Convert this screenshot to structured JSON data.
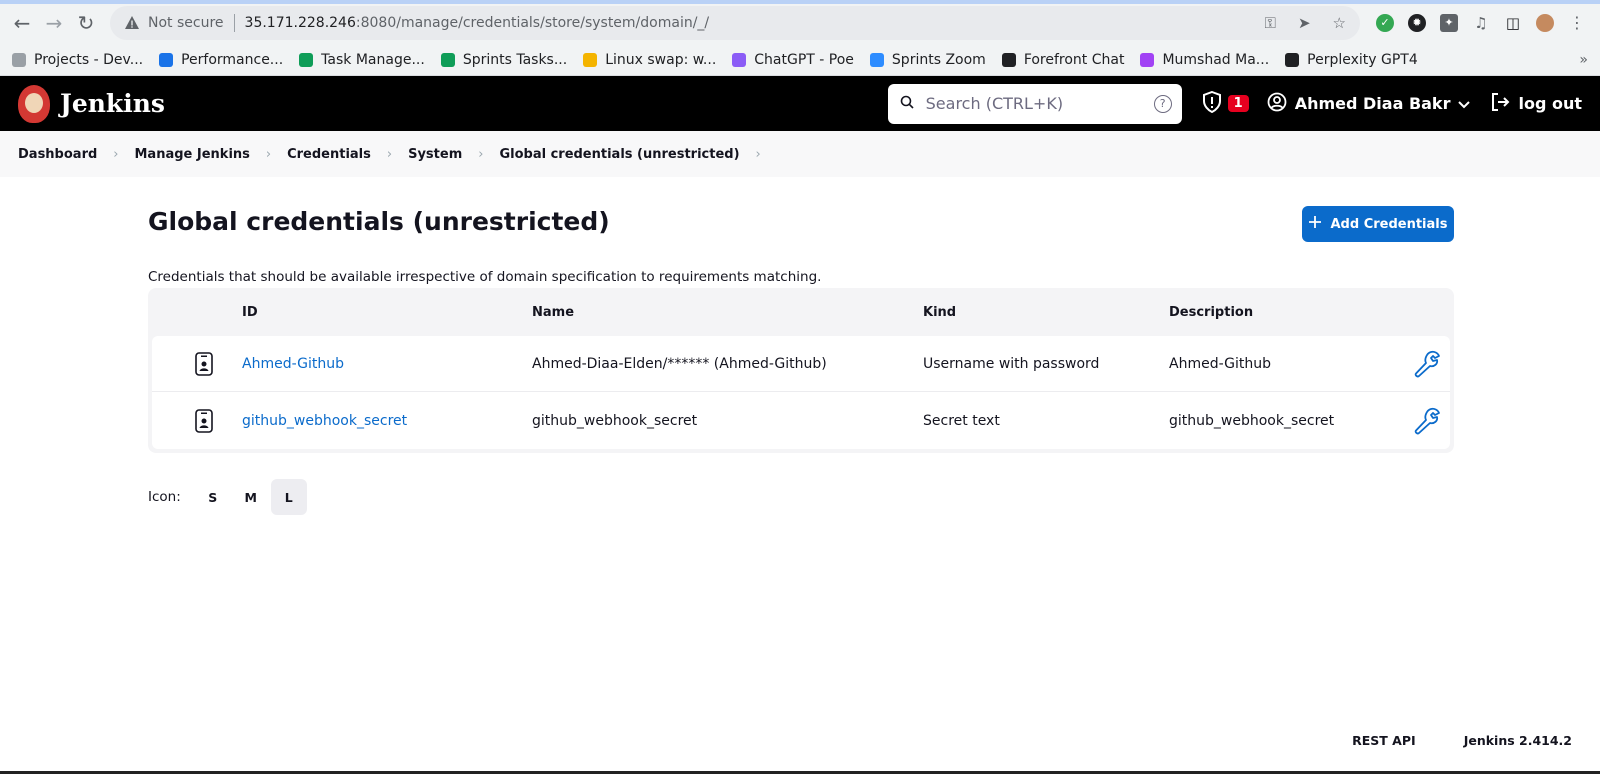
{
  "browser": {
    "security_label": "Not secure",
    "url_host": "35.171.228.246",
    "url_path": ":8080/manage/credentials/store/system/domain/_/",
    "bookmarks": [
      {
        "label": "Projects - Dev...",
        "color": "#9aa0a6"
      },
      {
        "label": "Performance...",
        "color": "#1a73e8"
      },
      {
        "label": "Task Manage...",
        "color": "#0f9d58"
      },
      {
        "label": "Sprints Tasks...",
        "color": "#0f9d58"
      },
      {
        "label": "Linux swap: w...",
        "color": "#f4b400"
      },
      {
        "label": "ChatGPT - Poe",
        "color": "#8b5cf6"
      },
      {
        "label": "Sprints Zoom",
        "color": "#2d8cff"
      },
      {
        "label": "Forefront Chat",
        "color": "#202124"
      },
      {
        "label": "Mumshad Ma...",
        "color": "#a142f4"
      },
      {
        "label": "Perplexity GPT4",
        "color": "#202124"
      }
    ],
    "more": "»"
  },
  "header": {
    "title": "Jenkins",
    "search_placeholder": "Search (CTRL+K)",
    "help": "?",
    "security_count": "1",
    "user_name": "Ahmed Diaa Bakr",
    "logout_label": "log out"
  },
  "breadcrumbs": [
    "Dashboard",
    "Manage Jenkins",
    "Credentials",
    "System",
    "Global credentials (unrestricted)"
  ],
  "page": {
    "title": "Global credentials (unrestricted)",
    "add_button": "Add Credentials",
    "description": "Credentials that should be available irrespective of domain specification to requirements matching."
  },
  "table": {
    "headers": {
      "id": "ID",
      "name": "Name",
      "kind": "Kind",
      "description": "Description"
    },
    "rows": [
      {
        "id": "Ahmed-Github",
        "name": "Ahmed-Diaa-Elden/****** (Ahmed-Github)",
        "kind": "Username with password",
        "description": "Ahmed-Github"
      },
      {
        "id": "github_webhook_secret",
        "name": "github_webhook_secret",
        "kind": "Secret text",
        "description": "github_webhook_secret"
      }
    ]
  },
  "icon_size": {
    "label": "Icon:",
    "options": [
      "S",
      "M",
      "L"
    ],
    "selected": "L"
  },
  "footer": {
    "rest_api": "REST API",
    "version": "Jenkins 2.414.2"
  },
  "colors": {
    "accent": "#0b6bcb",
    "header_bg": "#000000",
    "badge": "#e6001f"
  }
}
